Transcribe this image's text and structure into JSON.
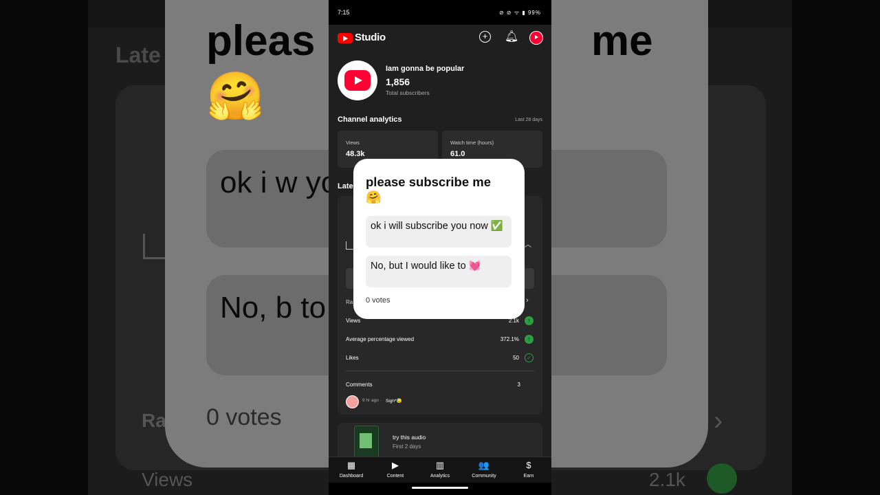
{
  "status": {
    "time": "7:15",
    "battery": "99%"
  },
  "app": {
    "name": "Studio"
  },
  "channel": {
    "name": "Iam gonna be popular",
    "subscribers": "1,856",
    "subscribers_label": "Total subscribers"
  },
  "analytics": {
    "title": "Channel analytics",
    "range": "Last 28 days",
    "cards": [
      {
        "label": "Views",
        "value": "48.3k"
      },
      {
        "label": "Watch time (hours)",
        "value": "61.0"
      }
    ]
  },
  "latest": {
    "title": "Late",
    "rank_label": "Ra",
    "metrics": [
      {
        "label": "Views",
        "value": "2.1k",
        "trend": "up"
      },
      {
        "label": "Average percentage viewed",
        "value": "372.1%",
        "trend": "up"
      },
      {
        "label": "Likes",
        "value": "50",
        "trend": "check"
      }
    ],
    "comments": {
      "label": "Comments",
      "count": "3",
      "time": "9 hr ago · ",
      "text": "Sigh*😓"
    }
  },
  "video2": {
    "title": "try this audio",
    "subtitle": "First 2 days"
  },
  "nav": [
    {
      "label": "Dashboard",
      "icon": "dashboard-icon",
      "glyph": "▦"
    },
    {
      "label": "Content",
      "icon": "content-icon",
      "glyph": "▶"
    },
    {
      "label": "Analytics",
      "icon": "analytics-icon",
      "glyph": "▥"
    },
    {
      "label": "Community",
      "icon": "community-icon",
      "glyph": "👥"
    },
    {
      "label": "Earn",
      "icon": "earn-icon",
      "glyph": "$"
    }
  ],
  "poll": {
    "question": "please subscribe me",
    "question_emoji": "🤗",
    "options": [
      "ok i will subscribe you now ✅",
      "No, but I would like to 💓"
    ],
    "votes": "0 votes"
  },
  "background": {
    "title_left": "pleas",
    "title_right": "me",
    "latest_left": "Late",
    "option1": "ok i w you n",
    "option2": "No, b to 💓",
    "votes": "0 votes",
    "rank": "Ra",
    "views": "Views",
    "views_value": "2.1k",
    "emoji": "🤗"
  },
  "colors": {
    "accent": "#ff0033",
    "positive": "#2e9e45",
    "surface": "#282828"
  }
}
